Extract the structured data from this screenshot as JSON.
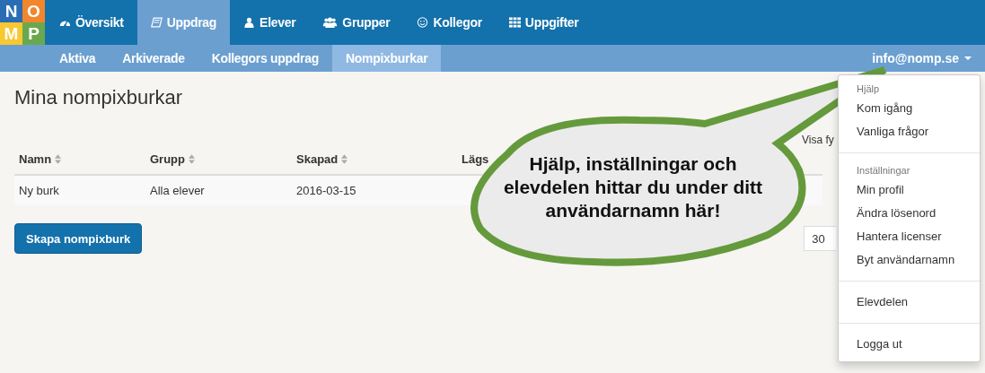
{
  "logo": [
    {
      "letter": "N",
      "color": "#2a6db5"
    },
    {
      "letter": "O",
      "color": "#f2862c"
    },
    {
      "letter": "M",
      "color": "#f8c832"
    },
    {
      "letter": "P",
      "color": "#6aa84f"
    }
  ],
  "nav": {
    "tabs": [
      {
        "label": "Översikt",
        "kind": "gauge",
        "selected": false
      },
      {
        "label": "Uppdrag",
        "kind": "book",
        "selected": true
      },
      {
        "label": "Elever",
        "kind": "user",
        "selected": false
      },
      {
        "label": "Grupper",
        "kind": "users",
        "selected": false
      },
      {
        "label": "Kollegor",
        "kind": "smiley",
        "selected": false
      },
      {
        "label": "Uppgifter",
        "kind": "grid",
        "selected": false
      }
    ]
  },
  "subnav": {
    "tabs": [
      {
        "label": "Aktiva",
        "selected": false
      },
      {
        "label": "Arkiverade",
        "selected": false
      },
      {
        "label": "Kollegors uppdrag",
        "selected": false
      },
      {
        "label": "Nompixburkar",
        "selected": true
      }
    ],
    "user": "info@nomp.se"
  },
  "page": {
    "title": "Mina nompixburkar",
    "filter_label": "Visa fy",
    "table": {
      "columns": [
        {
          "label": "Namn",
          "sortable": true
        },
        {
          "label": "Grupp",
          "sortable": true
        },
        {
          "label": "Skapad",
          "sortable": true
        },
        {
          "label": "Lägs",
          "sortable": false
        }
      ],
      "rows": [
        [
          "Ny burk",
          "Alla elever",
          "2016-03-15"
        ]
      ]
    },
    "count_field": "30",
    "create_button": "Skapa nompixburk"
  },
  "dropdown": [
    {
      "kind": "header",
      "label": "Hjälp"
    },
    {
      "kind": "item",
      "label": "Kom igång"
    },
    {
      "kind": "item",
      "label": "Vanliga frågor"
    },
    {
      "kind": "divider"
    },
    {
      "kind": "header",
      "label": "Inställningar"
    },
    {
      "kind": "item",
      "label": "Min profil"
    },
    {
      "kind": "item",
      "label": "Ändra lösenord"
    },
    {
      "kind": "item",
      "label": "Hantera licenser"
    },
    {
      "kind": "item",
      "label": "Byt användarnamn"
    },
    {
      "kind": "divider"
    },
    {
      "kind": "item",
      "label": "Elevdelen"
    },
    {
      "kind": "divider"
    },
    {
      "kind": "item",
      "label": "Logga ut"
    }
  ],
  "callout": "Hjälp, inställningar och\nelevdelen hittar du under ditt\nanvändarnamn här!"
}
